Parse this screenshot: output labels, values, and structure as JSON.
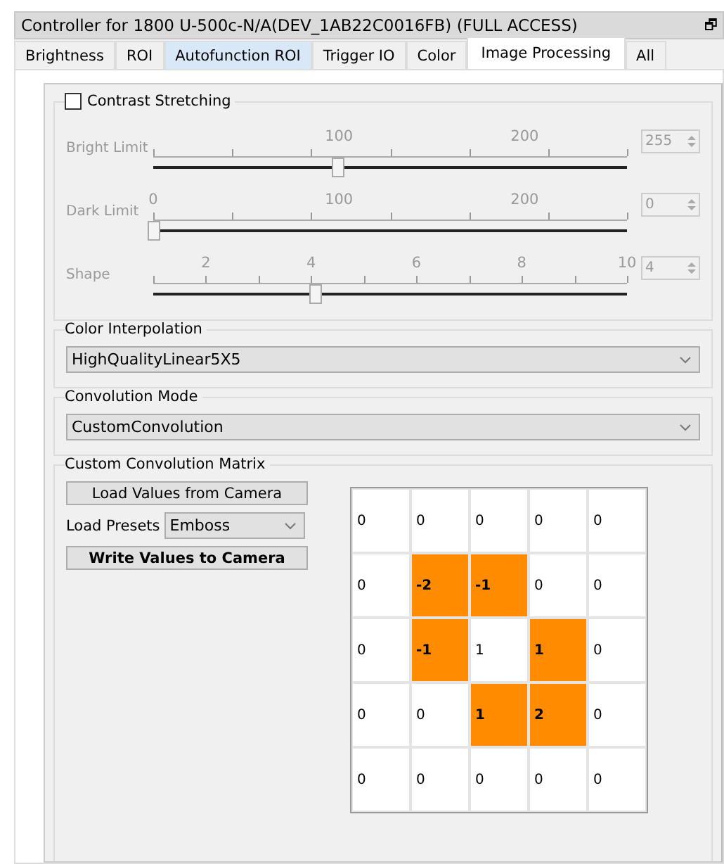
{
  "window": {
    "title": "Controller for 1800 U-500c-N/A(DEV_1AB22C0016FB) (FULL ACCESS)",
    "restore_icon": "🗗"
  },
  "tabs": [
    {
      "label": "Brightness",
      "selected": false,
      "hovered": false
    },
    {
      "label": "ROI",
      "selected": false,
      "hovered": false
    },
    {
      "label": "Autofunction ROI",
      "selected": false,
      "hovered": true
    },
    {
      "label": "Trigger IO",
      "selected": false,
      "hovered": false
    },
    {
      "label": "Color",
      "selected": false,
      "hovered": false
    },
    {
      "label": "Image Processing",
      "selected": true,
      "hovered": false
    },
    {
      "label": "All",
      "selected": false,
      "hovered": false
    }
  ],
  "contrast_stretching": {
    "label": "Contrast Stretching",
    "checked": false,
    "disabled": true,
    "sliders": [
      {
        "label": "Bright Limit",
        "ticks": [
          "100",
          "200"
        ],
        "level": 0.39,
        "value": "255"
      },
      {
        "label": "Dark Limit",
        "ticks": [
          "0",
          "100",
          "200"
        ],
        "level": 0.0,
        "value": "0"
      },
      {
        "label": "Shape",
        "ticks": [
          "2",
          "4",
          "6",
          "8",
          "10"
        ],
        "level": 0.34,
        "value": "4"
      }
    ]
  },
  "color_interpolation": {
    "label": "Color Interpolation",
    "value": "HighQualityLinear5X5"
  },
  "convolution_mode": {
    "label": "Convolution Mode",
    "value": "CustomConvolution"
  },
  "custom_matrix": {
    "label": "Custom Convolution Matrix",
    "load_button": "Load Values from Camera",
    "presets_label": "Load Presets",
    "preset": "Emboss",
    "write_button": "Write Values to Camera",
    "rows": [
      [
        {
          "value": "0",
          "highlighted": false
        },
        {
          "value": "0",
          "highlighted": false
        },
        {
          "value": "0",
          "highlighted": false
        },
        {
          "value": "0",
          "highlighted": false
        },
        {
          "value": "0",
          "highlighted": false
        }
      ],
      [
        {
          "value": "0",
          "highlighted": false
        },
        {
          "value": "-2",
          "highlighted": true
        },
        {
          "value": "-1",
          "highlighted": true
        },
        {
          "value": "0",
          "highlighted": false
        },
        {
          "value": "0",
          "highlighted": false
        }
      ],
      [
        {
          "value": "0",
          "highlighted": false
        },
        {
          "value": "-1",
          "highlighted": true
        },
        {
          "value": "1",
          "highlighted": false
        },
        {
          "value": "1",
          "highlighted": true
        },
        {
          "value": "0",
          "highlighted": false
        }
      ],
      [
        {
          "value": "0",
          "highlighted": false
        },
        {
          "value": "0",
          "highlighted": false
        },
        {
          "value": "1",
          "highlighted": true
        },
        {
          "value": "2",
          "highlighted": true
        },
        {
          "value": "0",
          "highlighted": false
        }
      ],
      [
        {
          "value": "0",
          "highlighted": false
        },
        {
          "value": "0",
          "highlighted": false
        },
        {
          "value": "0",
          "highlighted": false
        },
        {
          "value": "0",
          "highlighted": false
        },
        {
          "value": "0",
          "highlighted": false
        }
      ]
    ]
  }
}
